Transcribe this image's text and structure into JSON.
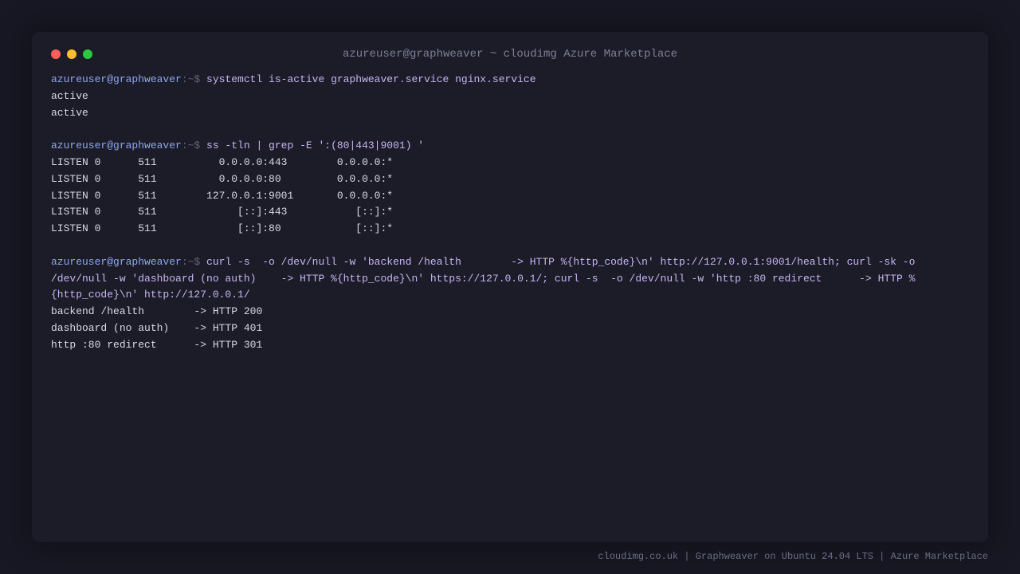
{
  "colors": {
    "close": "#ff5f57",
    "minimize": "#febc2e",
    "maximize": "#28c840",
    "prompt_user": "#8ea6ee",
    "command": "#c8b3f2",
    "output": "#d8d9e6"
  },
  "window": {
    "title": "azureuser@graphweaver ~ cloudimg Azure Marketplace"
  },
  "prompt": {
    "user_host": "azureuser@graphweaver",
    "path_symbol": ":~$ "
  },
  "session": {
    "cmd1": "systemctl is-active graphweaver.service nginx.service",
    "cmd1_output": [
      "active",
      "active"
    ],
    "cmd2": "ss -tln | grep -E ':(80|443|9001) '",
    "cmd2_output": [
      "LISTEN 0      511          0.0.0.0:443        0.0.0.0:*",
      "LISTEN 0      511          0.0.0.0:80         0.0.0.0:*",
      "LISTEN 0      511        127.0.0.1:9001       0.0.0.0:*",
      "LISTEN 0      511             [::]:443           [::]:*",
      "LISTEN 0      511             [::]:80            [::]:*"
    ],
    "cmd3_line1": "curl -s  -o /dev/null -w 'backend /health        -> HTTP %{http_code}\\n' http://127.0.0.1:9001/health; curl -sk -o",
    "cmd3_line2": "/dev/null -w 'dashboard (no auth)    -> HTTP %{http_code}\\n' https://127.0.0.1/; curl -s  -o /dev/null -w 'http :80 redirect      -> HTTP %",
    "cmd3_line3": "{http_code}\\n' http://127.0.0.1/",
    "cmd3_output": [
      "backend /health        -> HTTP 200",
      "dashboard (no auth)    -> HTTP 401",
      "http :80 redirect      -> HTTP 301"
    ]
  },
  "footer": {
    "text": "cloudimg.co.uk | Graphweaver on Ubuntu 24.04 LTS | Azure Marketplace"
  }
}
